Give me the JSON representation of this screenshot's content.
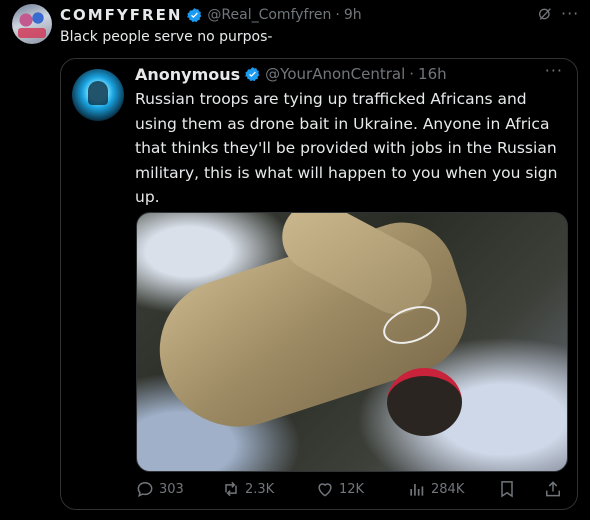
{
  "outer_post": {
    "display_name": "COMFYFREN",
    "handle": "@Real_Comfyfren",
    "separator": "·",
    "time": "9h",
    "text": "Black people serve no purpos-"
  },
  "quoted_post": {
    "display_name": "Anonymous",
    "handle": "@YourAnonCentral",
    "separator": "·",
    "time": "16h",
    "text": "Russian troops are tying up trafficked Africans and using them as drone bait in Ukraine. Anyone in Africa that thinks they'll be provided with jobs in the Russian military, this is what will happen to you when you sign up."
  },
  "actions": {
    "replies": "303",
    "reposts": "2.3K",
    "likes": "12K",
    "views": "284K"
  },
  "colors": {
    "background": "#000000",
    "text": "#e7e9ea",
    "muted": "#71767b",
    "verified": "#1d9bf0",
    "border": "#2f3336"
  },
  "icons": [
    "verified-badge-icon",
    "grok-icon",
    "more-icon",
    "reply-icon",
    "repost-icon",
    "like-icon",
    "views-icon",
    "bookmark-icon",
    "share-icon"
  ]
}
